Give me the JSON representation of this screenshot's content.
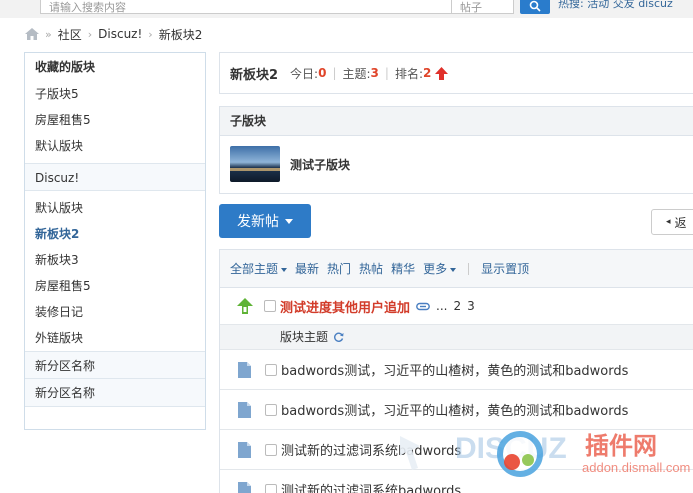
{
  "topbar": {
    "search_placeholder": "请输入搜索内容",
    "search_type": "帖子",
    "user_links": "热搜: 活动 交友 discuz"
  },
  "breadcrumb": {
    "items": [
      "社区",
      "Discuz!",
      "新板块2"
    ]
  },
  "sidebar": {
    "fav_title": "收藏的版块",
    "fav_items": [
      "子版块5",
      "房屋租售5",
      "默认版块"
    ],
    "group_title": "Discuz!",
    "group_items": [
      "默认版块",
      "新板块2",
      "新板块3",
      "房屋租售5",
      "装修日记",
      "外链版块"
    ],
    "active_item": "新板块2",
    "extra_groups": [
      "新分区名称",
      "新分区名称"
    ]
  },
  "forum": {
    "title": "新板块2",
    "today_label": "今日:",
    "today_value": "0",
    "topics_label": "主题:",
    "topics_value": "3",
    "rank_label": "排名:",
    "rank_value": "2"
  },
  "subforum": {
    "section_title": "子版块",
    "name": "测试子版块"
  },
  "actions": {
    "post_label": "发新帖",
    "back_label": "返"
  },
  "filters": {
    "items": [
      "全部主题",
      "最新",
      "热门",
      "热帖",
      "精华",
      "更多"
    ],
    "show_top": "显示置顶"
  },
  "pinned": {
    "title": "测试进度其他用户追加",
    "pages": [
      "...",
      "2",
      "3"
    ]
  },
  "section_head": "版块主题",
  "threads": [
    "badwords测试，习近平的山楂树，黄色的测试和badwords",
    "badwords测试，习近平的山楂树，黄色的测试和badwords",
    "测试新的过滤词系统badwords",
    "测试新的过滤词系统badwords"
  ],
  "colors": {
    "accent": "#2e7bc7",
    "stat": "#e0452a",
    "pinned": "#d23c2a",
    "link": "#336699"
  },
  "icons": [
    "home-icon",
    "search-icon",
    "rank-up-icon",
    "pin-up-icon",
    "attach-icon",
    "refresh-icon",
    "doc-icon"
  ]
}
